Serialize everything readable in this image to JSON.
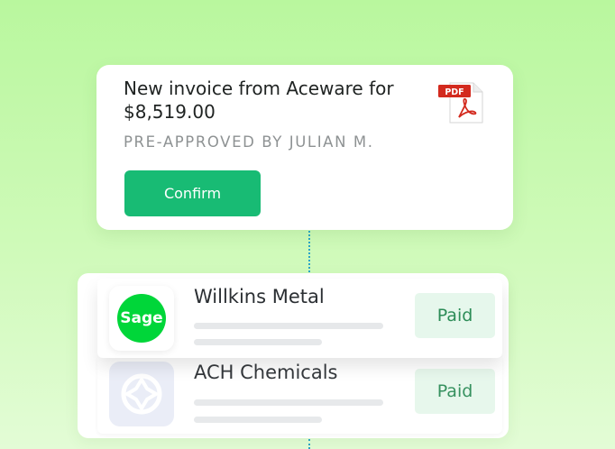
{
  "invoice": {
    "title": "New invoice from Aceware for $8,519.00",
    "subtitle": "PRE-APPROVED BY JULIAN M.",
    "confirm_label": "Confirm",
    "pdf_badge": "PDF"
  },
  "payments": [
    {
      "vendor": "Willkins Metal",
      "logo_text": "Sage",
      "logo_color": "#00d639",
      "status": "Paid"
    },
    {
      "vendor": "ACH Chemicals",
      "status": "Paid"
    }
  ],
  "colors": {
    "confirm": "#18bb74",
    "paid_bg": "#e6f7ec",
    "paid_text": "#2c8c57",
    "connector": "#2aa6c8"
  }
}
